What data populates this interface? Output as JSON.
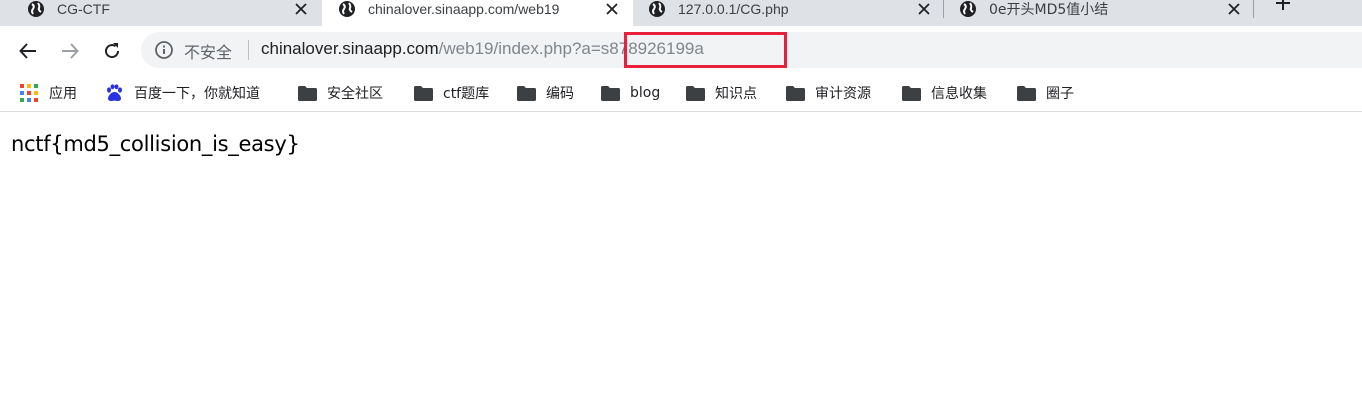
{
  "tabs": [
    {
      "title": "CG-CTF",
      "icon": "globe-icon",
      "active": false
    },
    {
      "title": "chinalover.sinaapp.com/web19",
      "icon": "globe-icon",
      "active": true
    },
    {
      "title": "127.0.0.1/CG.php",
      "icon": "globe-icon",
      "active": false
    },
    {
      "title": "0e开头MD5值小结",
      "icon": "globe-icon",
      "active": false
    }
  ],
  "toolbar": {
    "security_label": "不安全",
    "url_host": "chinalover.sinaapp.com",
    "url_path": "/web19/index.php?",
    "url_query": "a=s878926199a"
  },
  "bookmarks": [
    {
      "label": "应用",
      "icon": "apps-grid-icon"
    },
    {
      "label": "百度一下，你就知道",
      "icon": "baidu-paw-icon"
    },
    {
      "label": "安全社区",
      "icon": "folder-icon"
    },
    {
      "label": "ctf题库",
      "icon": "folder-icon"
    },
    {
      "label": "编码",
      "icon": "folder-icon"
    },
    {
      "label": "blog",
      "icon": "folder-icon"
    },
    {
      "label": "知识点",
      "icon": "folder-icon"
    },
    {
      "label": "审计资源",
      "icon": "folder-icon"
    },
    {
      "label": "信息收集",
      "icon": "folder-icon"
    },
    {
      "label": "圈子",
      "icon": "folder-icon"
    }
  ],
  "page": {
    "body_text": "nctf{md5_collision_is_easy}"
  },
  "colors": {
    "tabstrip": "#dee1e6",
    "omnibox": "#f1f3f4",
    "highlight": "#e8203b",
    "baidu_blue": "#2932e1"
  }
}
